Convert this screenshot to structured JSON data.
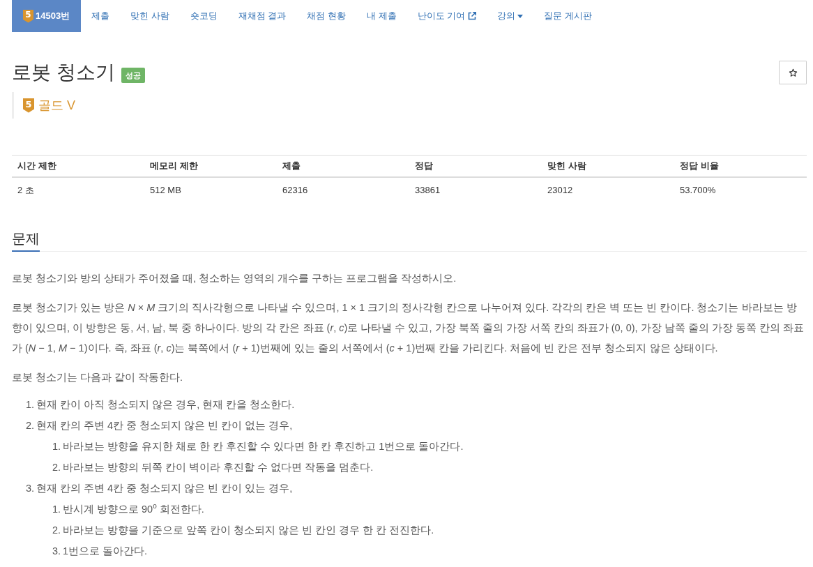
{
  "nav": {
    "items": [
      {
        "label": "14503번",
        "kind": "problem",
        "badge": "5",
        "selected": true
      },
      {
        "label": "제출",
        "kind": "link",
        "selected": false
      },
      {
        "label": "맞힌 사람",
        "kind": "link",
        "selected": false
      },
      {
        "label": "숏코딩",
        "kind": "link",
        "selected": false
      },
      {
        "label": "재채점 결과",
        "kind": "link",
        "selected": false
      },
      {
        "label": "채점 현황",
        "kind": "link",
        "selected": false
      },
      {
        "label": "내 제출",
        "kind": "link",
        "selected": false
      },
      {
        "label": "난이도 기여",
        "kind": "external",
        "selected": false
      },
      {
        "label": "강의",
        "kind": "dropdown",
        "selected": false
      },
      {
        "label": "질문 게시판",
        "kind": "link",
        "selected": false
      }
    ]
  },
  "problem": {
    "title": "로봇 청소기",
    "result": "성공",
    "tier": {
      "badge": "5",
      "label": "골드 V"
    }
  },
  "stats": {
    "columns": [
      "시간 제한",
      "메모리 제한",
      "제출",
      "정답",
      "맞힌 사람",
      "정답 비율"
    ],
    "rows": [
      [
        "2 초",
        "512 MB",
        "62316",
        "33861",
        "23012",
        "53.700%"
      ]
    ]
  },
  "description": {
    "title": "문제",
    "paragraphs": [
      "로봇 청소기와 방의 상태가 주어졌을 때, 청소하는 영역의 개수를 구하는 프로그램을 작성하시오.",
      "로봇 청소기가 있는 방은 *N* × *M* 크기의 직사각형으로 나타낼 수 있으며, 1 × 1 크기의 정사각형 칸으로 나누어져 있다. 각각의 칸은 벽 또는 빈 칸이다. 청소기는 바라보는 방향이 있으며, 이 방향은 동, 서, 남, 북 중 하나이다. 방의 각 칸은 좌표 (*r*, *c*)로 나타낼 수 있고, 가장 북쪽 줄의 가장 서쪽 칸의 좌표가 (0, 0), 가장 남쪽 줄의 가장 동쪽 칸의 좌표가 (*N* − 1, *M* − 1)이다. 즉, 좌표 (*r*, *c*)는 북쪽에서 (*r* + 1)번째에 있는 줄의 서쪽에서 (*c* + 1)번째 칸을 가리킨다. 처음에 빈 칸은 전부 청소되지 않은 상태이다.",
      "로봇 청소기는 다음과 같이 작동한다."
    ],
    "steps": [
      {
        "number": "1.",
        "text": "현재 칸이 아직 청소되지 않은 경우, 현재 칸을 청소한다."
      },
      {
        "number": "2.",
        "text": "현재 칸의 주변 4칸 중 청소되지 않은 빈 칸이 없는 경우,",
        "children": [
          {
            "number": "1.",
            "text": "바라보는 방향을 유지한 채로 한 칸 후진할 수 있다면 한 칸 후진하고 1번으로 돌아간다."
          },
          {
            "number": "2.",
            "text": "바라보는 방향의 뒤쪽 칸이 벽이라 후진할 수 없다면 작동을 멈춘다."
          }
        ]
      },
      {
        "number": "3.",
        "text": "현재 칸의 주변 4칸 중 청소되지 않은 빈 칸이 있는 경우,",
        "children": [
          {
            "number": "1.",
            "text": "반시계 방향으로 90$^{o}$ 회전한다."
          },
          {
            "number": "2.",
            "text": "바라보는 방향을 기준으로 앞쪽 칸이 청소되지 않은 빈 칸인 경우 한 칸 전진한다."
          },
          {
            "number": "3.",
            "text": "1번으로 돌아간다."
          }
        ]
      }
    ]
  }
}
